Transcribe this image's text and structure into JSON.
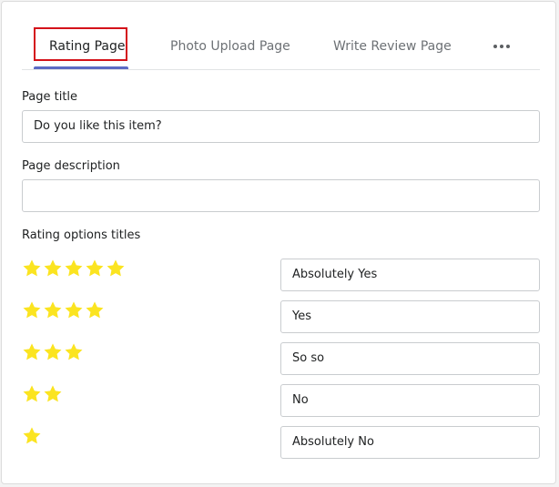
{
  "tabs": [
    {
      "label": "Rating Page",
      "active": true
    },
    {
      "label": "Photo Upload Page",
      "active": false
    },
    {
      "label": "Write Review Page",
      "active": false
    }
  ],
  "more_icon": "more-horizontal-icon",
  "page_title": {
    "label": "Page title",
    "value": "Do you like this item?"
  },
  "page_description": {
    "label": "Page description",
    "value": ""
  },
  "rating_options": {
    "label": "Rating options titles",
    "star_color": "#fbe420",
    "options": [
      {
        "stars": 5,
        "title": "Absolutely Yes"
      },
      {
        "stars": 4,
        "title": "Yes"
      },
      {
        "stars": 3,
        "title": "So so"
      },
      {
        "stars": 2,
        "title": "No"
      },
      {
        "stars": 1,
        "title": "Absolutely No"
      }
    ]
  },
  "colors": {
    "accent": "#5c6ac4",
    "highlight": "#d4121a"
  }
}
